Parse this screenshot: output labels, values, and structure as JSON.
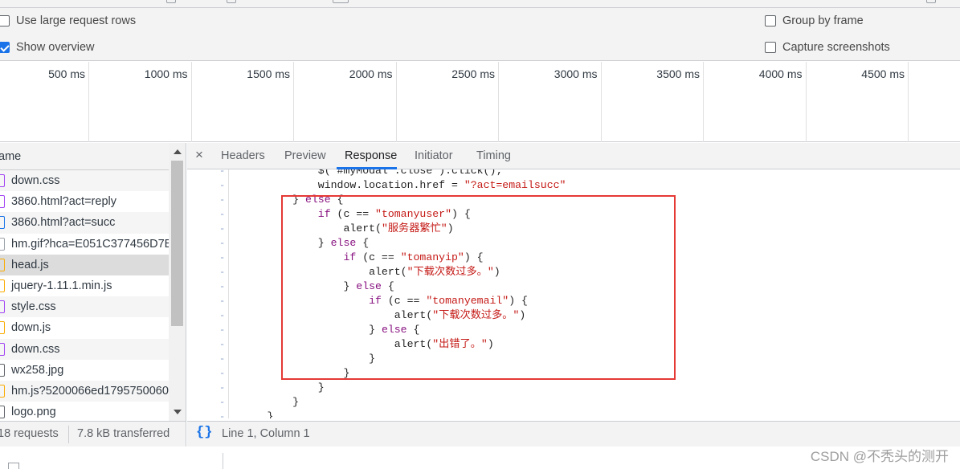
{
  "settings": {
    "large_rows": "Use large request rows",
    "show_overview": "Show overview",
    "group_by_frame": "Group by frame",
    "capture_screenshots": "Capture screenshots"
  },
  "overview": {
    "ticks": [
      "500 ms",
      "1000 ms",
      "1500 ms",
      "2000 ms",
      "2500 ms",
      "3000 ms",
      "3500 ms",
      "4000 ms",
      "4500 ms"
    ]
  },
  "request_list": {
    "column_header": "ame",
    "items": [
      {
        "name": "down.css",
        "icon": "css-file-icon",
        "color": "#a142f4"
      },
      {
        "name": "3860.html?act=reply",
        "icon": "doc-file-icon",
        "color": "#a142f4"
      },
      {
        "name": "3860.html?act=succ",
        "icon": "doc-file-icon",
        "color": "#1a73e8"
      },
      {
        "name": "hm.gif?hca=E051C377456D7E",
        "icon": "image-file-icon",
        "color": "#9aa0a6"
      },
      {
        "name": "head.js",
        "icon": "js-file-icon",
        "color": "#f9ab00"
      },
      {
        "name": "jquery-1.11.1.min.js",
        "icon": "js-file-icon",
        "color": "#f9ab00"
      },
      {
        "name": "style.css",
        "icon": "css-file-icon",
        "color": "#a142f4"
      },
      {
        "name": "down.js",
        "icon": "js-file-icon",
        "color": "#f9ab00"
      },
      {
        "name": "down.css",
        "icon": "css-file-icon",
        "color": "#a142f4"
      },
      {
        "name": "wx258.jpg",
        "icon": "image-file-icon",
        "color": "#5f6368"
      },
      {
        "name": "hm.js?5200066ed1795750060",
        "icon": "js-file-icon",
        "color": "#f9ab00"
      },
      {
        "name": "logo.png",
        "icon": "image-file-icon",
        "color": "#5f6368"
      }
    ]
  },
  "status_bar": {
    "requests": "18 requests",
    "transferred": "7.8 kB transferred"
  },
  "detail_tabs": {
    "close": "×",
    "headers": "Headers",
    "preview": "Preview",
    "response": "Response",
    "initiator": "Initiator",
    "timing": "Timing"
  },
  "code": {
    "lines": [
      {
        "indent": "              ",
        "parts": [
          {
            "t": "$('#myModal .close').click();",
            "c": ""
          }
        ]
      },
      {
        "indent": "              ",
        "parts": [
          {
            "t": "window.location.href = ",
            "c": ""
          },
          {
            "t": "\"?act=emailsucc\"",
            "c": "s"
          }
        ]
      },
      {
        "indent": "          ",
        "parts": [
          {
            "t": "} ",
            "c": ""
          },
          {
            "t": "else",
            "c": "k"
          },
          {
            "t": " {",
            "c": ""
          }
        ]
      },
      {
        "indent": "              ",
        "parts": [
          {
            "t": "if",
            "c": "k"
          },
          {
            "t": " (c == ",
            "c": ""
          },
          {
            "t": "\"tomanyuser\"",
            "c": "s"
          },
          {
            "t": ") {",
            "c": ""
          }
        ]
      },
      {
        "indent": "                  ",
        "parts": [
          {
            "t": "alert(",
            "c": ""
          },
          {
            "t": "\"服务器繁忙\"",
            "c": "s"
          },
          {
            "t": ")",
            "c": ""
          }
        ]
      },
      {
        "indent": "              ",
        "parts": [
          {
            "t": "} ",
            "c": ""
          },
          {
            "t": "else",
            "c": "k"
          },
          {
            "t": " {",
            "c": ""
          }
        ]
      },
      {
        "indent": "                  ",
        "parts": [
          {
            "t": "if",
            "c": "k"
          },
          {
            "t": " (c == ",
            "c": ""
          },
          {
            "t": "\"tomanyip\"",
            "c": "s"
          },
          {
            "t": ") {",
            "c": ""
          }
        ]
      },
      {
        "indent": "                      ",
        "parts": [
          {
            "t": "alert(",
            "c": ""
          },
          {
            "t": "\"下载次数过多。\"",
            "c": "s"
          },
          {
            "t": ")",
            "c": ""
          }
        ]
      },
      {
        "indent": "                  ",
        "parts": [
          {
            "t": "} ",
            "c": ""
          },
          {
            "t": "else",
            "c": "k"
          },
          {
            "t": " {",
            "c": ""
          }
        ]
      },
      {
        "indent": "                      ",
        "parts": [
          {
            "t": "if",
            "c": "k"
          },
          {
            "t": " (c == ",
            "c": ""
          },
          {
            "t": "\"tomanyemail\"",
            "c": "s"
          },
          {
            "t": ") {",
            "c": ""
          }
        ]
      },
      {
        "indent": "                          ",
        "parts": [
          {
            "t": "alert(",
            "c": ""
          },
          {
            "t": "\"下载次数过多。\"",
            "c": "s"
          },
          {
            "t": ")",
            "c": ""
          }
        ]
      },
      {
        "indent": "                      ",
        "parts": [
          {
            "t": "} ",
            "c": ""
          },
          {
            "t": "else",
            "c": "k"
          },
          {
            "t": " {",
            "c": ""
          }
        ]
      },
      {
        "indent": "                          ",
        "parts": [
          {
            "t": "alert(",
            "c": ""
          },
          {
            "t": "\"出错了。\"",
            "c": "s"
          },
          {
            "t": ")",
            "c": ""
          }
        ]
      },
      {
        "indent": "                      ",
        "parts": [
          {
            "t": "}",
            "c": ""
          }
        ]
      },
      {
        "indent": "                  ",
        "parts": [
          {
            "t": "}",
            "c": ""
          }
        ]
      },
      {
        "indent": "              ",
        "parts": [
          {
            "t": "}",
            "c": ""
          }
        ]
      },
      {
        "indent": "          ",
        "parts": [
          {
            "t": "}",
            "c": ""
          }
        ]
      },
      {
        "indent": "      ",
        "parts": [
          {
            "t": "}",
            "c": ""
          }
        ]
      }
    ],
    "gutter_mark": "-"
  },
  "response_status": {
    "format_icon": "{}",
    "cursor": "Line 1, Column 1"
  },
  "watermark": "CSDN @不秃头的测开"
}
